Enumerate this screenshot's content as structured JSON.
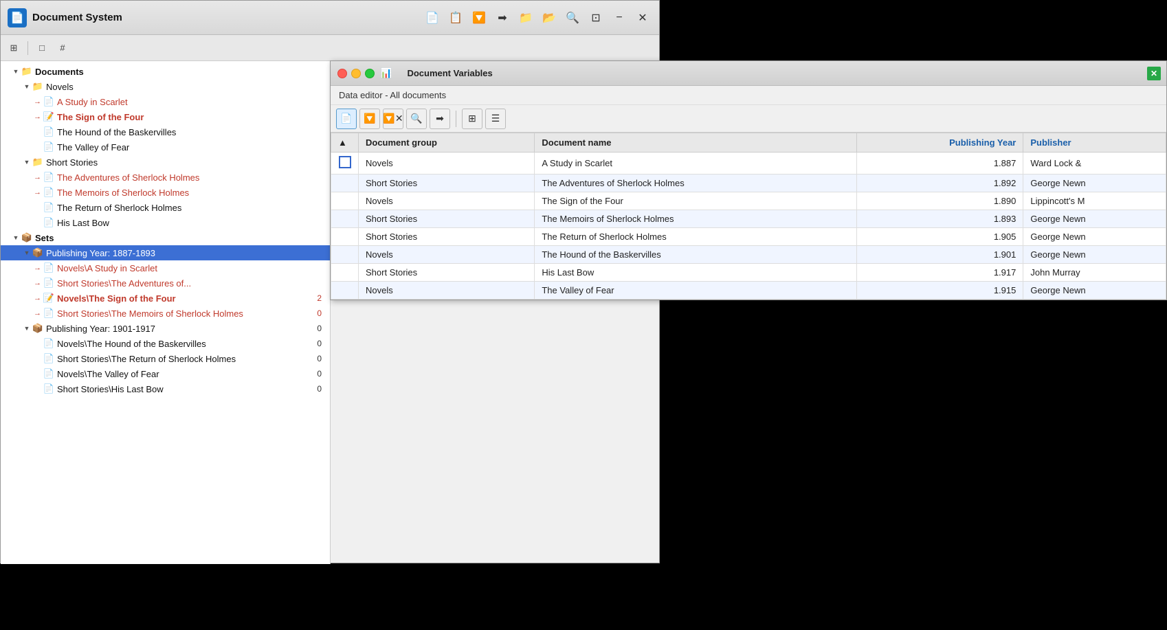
{
  "app": {
    "title": "Document System",
    "window_icon": "📄"
  },
  "toolbar": {
    "buttons": [
      {
        "label": "📄",
        "name": "new-doc"
      },
      {
        "label": "📋",
        "name": "copy"
      },
      {
        "label": "🔽",
        "name": "filter"
      },
      {
        "label": "➡",
        "name": "move-in"
      },
      {
        "label": "📁+",
        "name": "new-folder"
      },
      {
        "label": "📂+",
        "name": "open-folder"
      },
      {
        "label": "🔍",
        "name": "search"
      },
      {
        "label": "⊡",
        "name": "tile"
      },
      {
        "label": "−",
        "name": "minimize"
      },
      {
        "label": "✕",
        "name": "close"
      }
    ]
  },
  "tree": {
    "items": [
      {
        "level": 0,
        "label": "Documents",
        "icon": "📁",
        "type": "folder",
        "arrow": "expanded",
        "bold": true
      },
      {
        "level": 1,
        "label": "Novels",
        "icon": "📁",
        "type": "folder",
        "arrow": "expanded"
      },
      {
        "level": 2,
        "label": "A Study in Scarlet",
        "icon": "📄",
        "type": "doc",
        "red": true,
        "has_arrow": true
      },
      {
        "level": 2,
        "label": "The Sign of the Four",
        "icon": "📝",
        "type": "doc",
        "bold_red": true,
        "has_arrow": true
      },
      {
        "level": 2,
        "label": "The Hound of the Baskervilles",
        "icon": "📄",
        "type": "doc",
        "red": false
      },
      {
        "level": 2,
        "label": "The Valley of Fear",
        "icon": "📄",
        "type": "doc",
        "red": false
      },
      {
        "level": 1,
        "label": "Short Stories",
        "icon": "📁",
        "type": "folder",
        "arrow": "expanded"
      },
      {
        "level": 2,
        "label": "The Adventures of Sherlock Holmes",
        "icon": "📄",
        "type": "doc",
        "red": true,
        "has_arrow": true
      },
      {
        "level": 2,
        "label": "The Memoirs of Sherlock Holmes",
        "icon": "📄",
        "type": "doc",
        "red": true,
        "has_arrow": true
      },
      {
        "level": 2,
        "label": "The Return of Sherlock Holmes",
        "icon": "📄",
        "type": "doc",
        "red": false
      },
      {
        "level": 2,
        "label": "His Last Bow",
        "icon": "📄",
        "type": "doc",
        "red": false
      },
      {
        "level": 0,
        "label": "Sets",
        "icon": "📦",
        "type": "sets",
        "arrow": "expanded",
        "bold": true
      },
      {
        "level": 1,
        "label": "Publishing Year: 1887-1893",
        "icon": "📦",
        "type": "set",
        "arrow": "expanded",
        "selected": true
      },
      {
        "level": 2,
        "label": "Novels\\A Study in Scarlet",
        "icon": "📄",
        "type": "doc",
        "red": true,
        "has_arrow": true
      },
      {
        "level": 2,
        "label": "Short Stories\\The Adventures of...",
        "icon": "📄",
        "type": "doc",
        "red": true,
        "has_arrow": true
      },
      {
        "level": 2,
        "label": "Novels\\The Sign of the Four",
        "icon": "📝",
        "type": "doc",
        "bold_red": true,
        "has_arrow": true,
        "count": "2"
      },
      {
        "level": 2,
        "label": "Short Stories\\The Memoirs of Sherlock Holmes",
        "icon": "📄",
        "type": "doc",
        "red": true,
        "has_arrow": true,
        "count": "0"
      },
      {
        "level": 1,
        "label": "Publishing Year: 1901-1917",
        "icon": "📦",
        "type": "set",
        "arrow": "expanded",
        "count": "0"
      },
      {
        "level": 2,
        "label": "Novels\\The Hound of the Baskervilles",
        "icon": "📄",
        "type": "doc",
        "count": "0"
      },
      {
        "level": 2,
        "label": "Short Stories\\The Return of Sherlock Holmes",
        "icon": "📄",
        "type": "doc",
        "count": "0"
      },
      {
        "level": 2,
        "label": "Novels\\The Valley of Fear",
        "icon": "📄",
        "type": "doc",
        "count": "0"
      },
      {
        "level": 2,
        "label": "Short Stories\\His Last Bow",
        "icon": "📄",
        "type": "doc",
        "count": "0"
      }
    ]
  },
  "data_editor": {
    "title": "Document Variables",
    "title_icon": "📊",
    "subtitle": "Data editor - All documents",
    "columns": [
      {
        "label": "",
        "type": "checkbox"
      },
      {
        "label": "Document group",
        "type": "text"
      },
      {
        "label": "Document name",
        "type": "text"
      },
      {
        "label": "Publishing Year",
        "type": "number",
        "blue": true
      },
      {
        "label": "Publisher",
        "type": "text",
        "blue": true
      }
    ],
    "rows": [
      {
        "checkbox": true,
        "group": "Novels",
        "name": "A Study in Scarlet",
        "year": "1.887",
        "publisher": "Ward Lock &"
      },
      {
        "checkbox": false,
        "group": "Short Stories",
        "name": "The Adventures of Sherlock Holmes",
        "year": "1.892",
        "publisher": "George Newn"
      },
      {
        "checkbox": false,
        "group": "Novels",
        "name": "The Sign of the Four",
        "year": "1.890",
        "publisher": "Lippincott's M"
      },
      {
        "checkbox": false,
        "group": "Short Stories",
        "name": "The Memoirs of Sherlock Holmes",
        "year": "1.893",
        "publisher": "George Newn"
      },
      {
        "checkbox": false,
        "group": "Short Stories",
        "name": "The Return of Sherlock Holmes",
        "year": "1.905",
        "publisher": "George Newn"
      },
      {
        "checkbox": false,
        "group": "Novels",
        "name": "The Hound of the Baskervilles",
        "year": "1.901",
        "publisher": "George Newn"
      },
      {
        "checkbox": false,
        "group": "Short Stories",
        "name": "His Last Bow",
        "year": "1.917",
        "publisher": "John Murray"
      },
      {
        "checkbox": false,
        "group": "Novels",
        "name": "The Valley of Fear",
        "year": "1.915",
        "publisher": "George Newn"
      }
    ]
  }
}
